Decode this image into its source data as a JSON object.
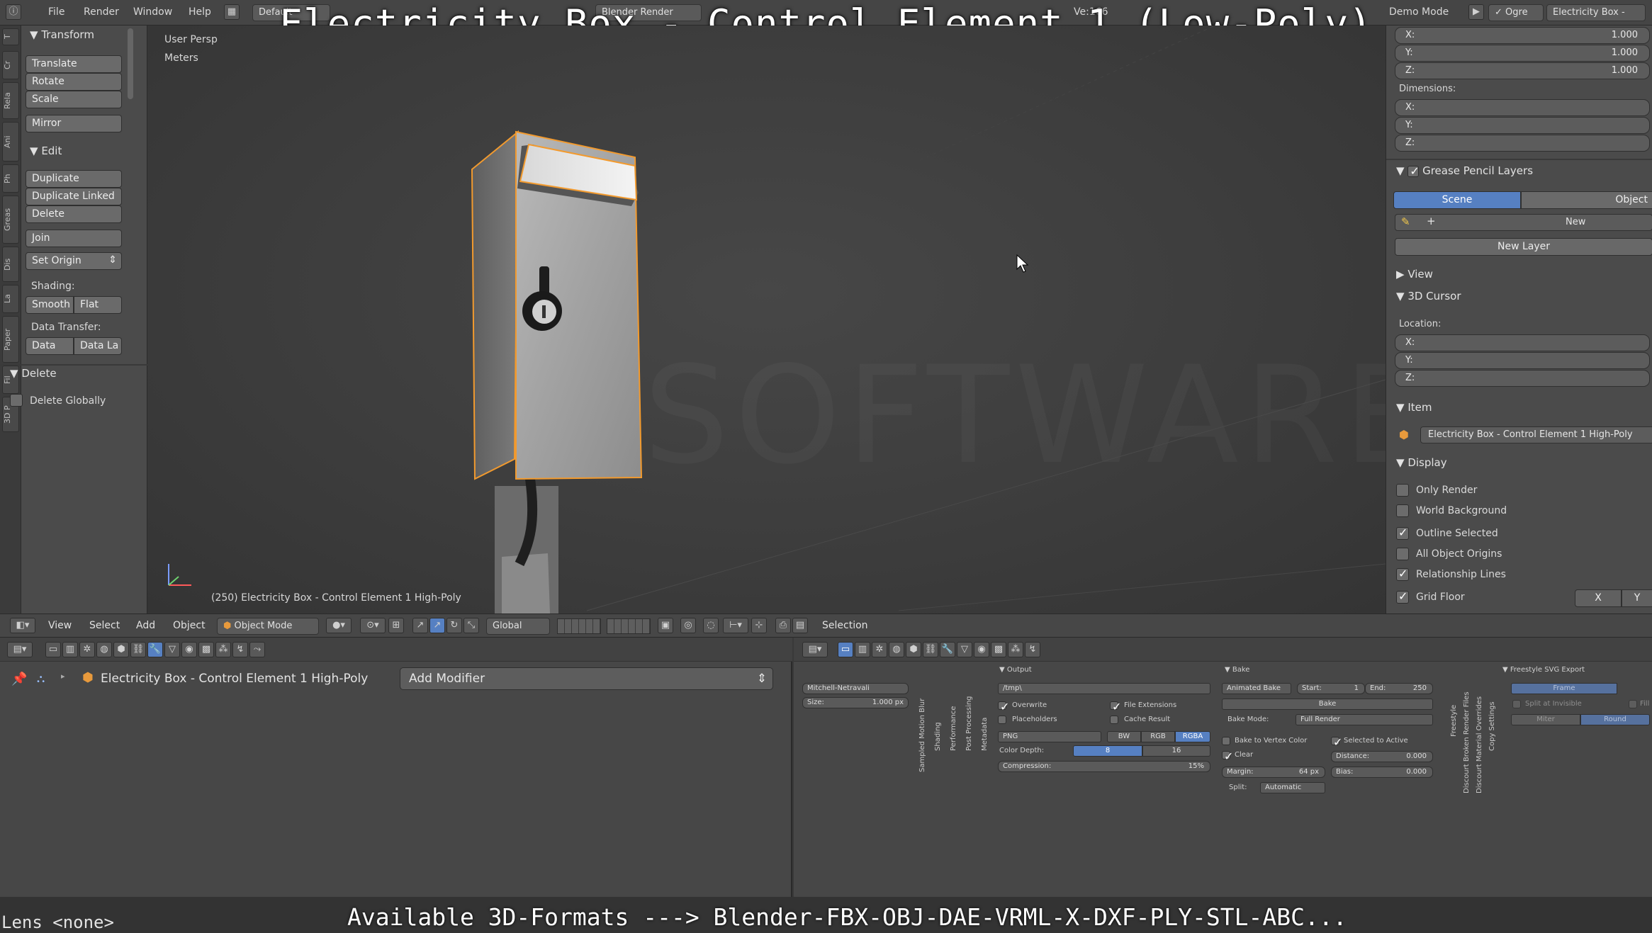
{
  "window": {
    "menus": [
      "File",
      "Render",
      "Window",
      "Help"
    ],
    "layout": "Default",
    "engine": "Blender Render",
    "stats": "Ve:166",
    "demo_mode": "Demo Mode",
    "ogre_label": "Ogre",
    "scene_name": "Electricity Box -"
  },
  "video_title": "Electricity Box - Control Element 1 (Low-Poly)",
  "tabs_left": [
    "T",
    "Cr",
    "Rela",
    "Ani",
    "Ph",
    "Greas",
    "Dis",
    "La",
    "Paper",
    "Fil",
    "3D P"
  ],
  "tool_shelf": {
    "transform_title": "Transform",
    "translate": "Translate",
    "rotate": "Rotate",
    "scale": "Scale",
    "mirror": "Mirror",
    "edit_title": "Edit",
    "duplicate": "Duplicate",
    "duplicate_linked": "Duplicate Linked",
    "delete": "Delete",
    "join": "Join",
    "set_origin": "Set Origin",
    "shading_label": "Shading:",
    "smooth": "Smooth",
    "flat": "Flat",
    "data_transfer_label": "Data Transfer:",
    "data": "Data",
    "data_la": "Data La",
    "delete_panel_title": "Delete",
    "delete_globally": "Delete Globally"
  },
  "viewport": {
    "view_name": "User Persp",
    "units": "Meters",
    "object_info": "(250) Electricity Box - Control Element 1 High-Poly"
  },
  "n_panel": {
    "scale_x_label": "X:",
    "scale_x": "1.000",
    "scale_y_label": "Y:",
    "scale_y": "1.000",
    "scale_z_label": "Z:",
    "scale_z": "1.000",
    "dimensions_label": "Dimensions:",
    "dim_x": "X:",
    "dim_y": "Y:",
    "dim_z": "Z:",
    "grease_pencil_layers": "Grease Pencil Layers",
    "scene_tab": "Scene",
    "object_tab": "Object",
    "new_label": "New",
    "new_layer": "New Layer",
    "view_section": "View",
    "cursor_section": "3D Cursor",
    "location_label": "Location:",
    "loc_x": "X:",
    "loc_y": "Y:",
    "loc_z": "Z:",
    "item_section": "Item",
    "item_name": "Electricity Box - Control Element 1 High-Poly",
    "display_section": "Display",
    "only_render": "Only Render",
    "world_background": "World Background",
    "outline_selected": "Outline Selected",
    "all_object_origins": "All Object Origins",
    "relationship_lines": "Relationship Lines",
    "grid_floor": "Grid Floor",
    "axis_x": "X",
    "axis_y": "Y"
  },
  "viewport_header": {
    "view": "View",
    "select": "Select",
    "add": "Add",
    "object": "Object",
    "mode": "Object Mode",
    "orientation": "Global",
    "selection": "Selection"
  },
  "modifiers": {
    "object_name": "Electricity Box - Control Element 1 High-Poly",
    "add_modifier": "Add Modifier"
  },
  "render_props": {
    "filter": "Mitchell-Netravali",
    "size_label": "Size:",
    "size_value": "1.000 px",
    "vertical_tabs": [
      "Sampled Motion Blur",
      "Shading",
      "Performance",
      "Post Processing",
      "Metadata"
    ],
    "output_title": "Output",
    "output_path": "/tmp\\",
    "overwrite": "Overwrite",
    "file_extensions": "File Extensions",
    "placeholders": "Placeholders",
    "cache_result": "Cache Result",
    "format": "PNG",
    "bw": "BW",
    "rgb": "RGB",
    "rgba": "RGBA",
    "color_depth": "Color Depth:",
    "depth_8": "8",
    "depth_16": "16",
    "compression": "Compression:",
    "compression_value": "15%",
    "bake_title": "Bake",
    "animated_bake": "Animated Bake",
    "start_label": "Start:",
    "start_value": "1",
    "end_label": "End:",
    "end_value": "250",
    "bake_button": "Bake",
    "bake_mode_label": "Bake Mode:",
    "bake_mode": "Full Render",
    "bake_vertex_color": "Bake to Vertex Color",
    "selected_to_active": "Selected to Active",
    "clear": "Clear",
    "distance_label": "Distance:",
    "distance_value": "0.000",
    "margin_label": "Margin:",
    "margin_value": "64 px",
    "bias_label": "Bias:",
    "bias_value": "0.000",
    "split_label": "Split:",
    "split_value": "Automatic",
    "vertical_tabs_right": [
      "Freestyle",
      "Discourt Broken Render Files",
      "Discourt Material Overrides",
      "Copy Settings"
    ],
    "freestyle_svg": "Freestyle SVG Export",
    "frame": "Frame",
    "split_at_invisible": "Split at Invisible",
    "fill": "Fill",
    "miter": "Miter",
    "round": "Round"
  },
  "status": {
    "lens": "Lens <none>",
    "caption": "Available 3D-Formats ---> Blender-FBX-OBJ-DAE-VRML-X-DXF-PLY-STL-ABC..."
  },
  "colors": {
    "accent_blue": "#5680c2",
    "selection_outline": "#f29a2e"
  }
}
